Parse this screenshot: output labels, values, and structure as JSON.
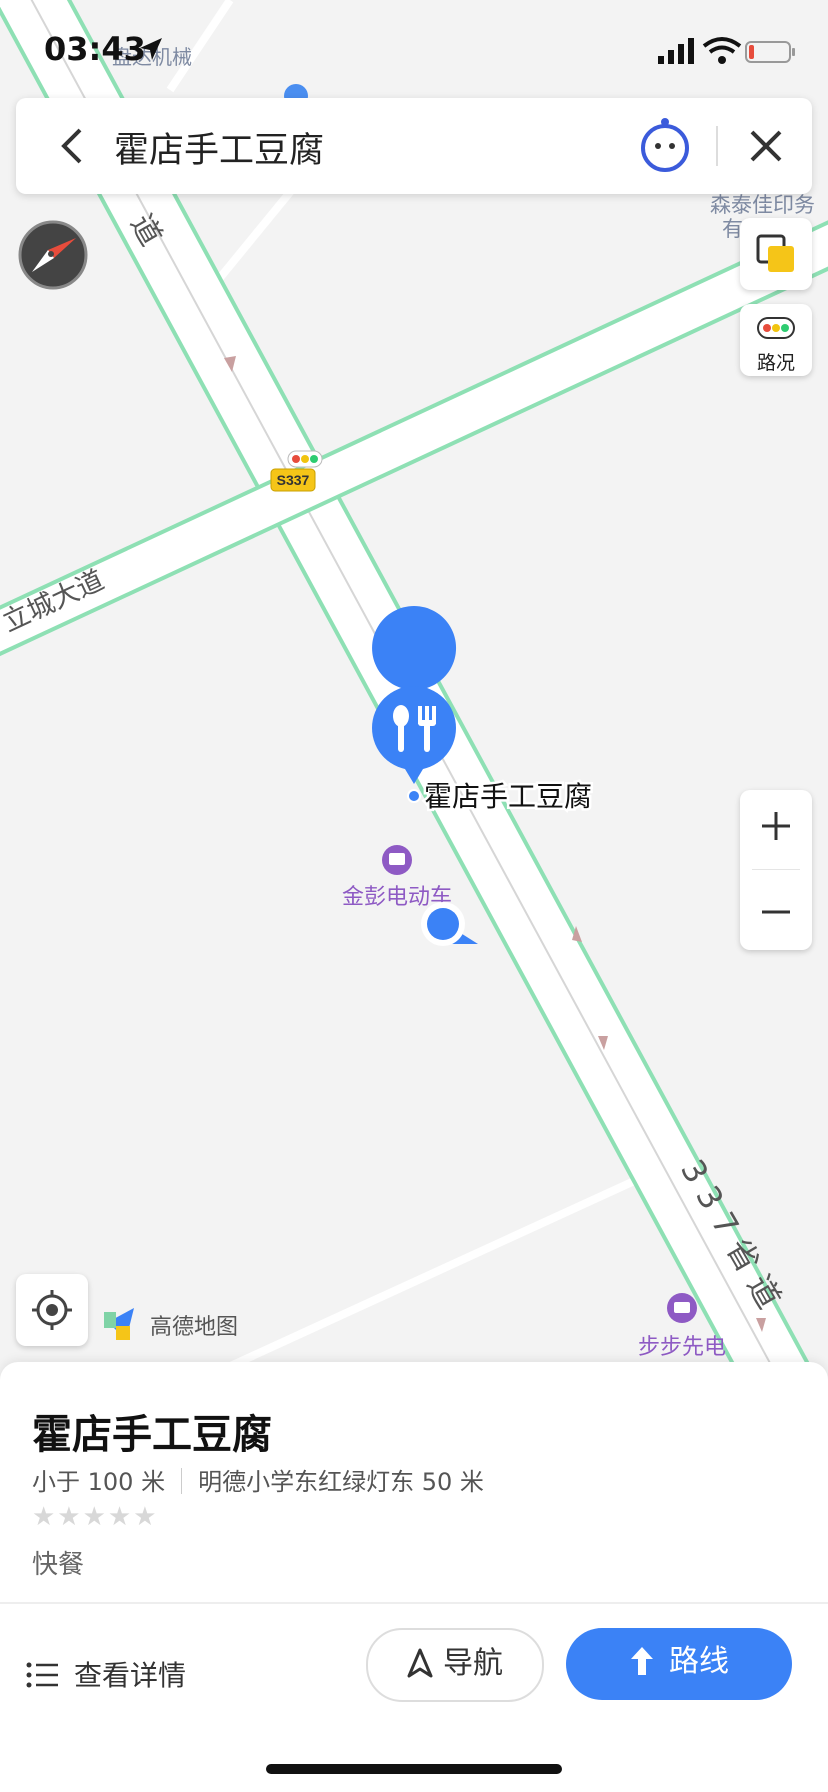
{
  "status_bar": {
    "time": "03:43"
  },
  "search": {
    "query": "霍店手工豆腐"
  },
  "map": {
    "labels": {
      "poi_top": "盘达机械",
      "road_left_vertical": "道",
      "road_left_diag": "立城大道",
      "road_shield": "S337",
      "poi_top_right": "森泰佳印务",
      "poi_top_right_2": "有",
      "selected_place": "霍店手工豆腐",
      "poi_ev": "金彭电动车",
      "road_right": "337省道",
      "poi_bottom_right": "步步先电",
      "brand": "高德地图"
    },
    "controls": {
      "traffic_label": "路况"
    }
  },
  "place": {
    "name": "霍店手工豆腐",
    "distance": "小于 100 米",
    "address": "明德小学东红绿灯东 50 米",
    "rating_stars": "★★★★★",
    "rating": 0,
    "category": "快餐"
  },
  "actions": {
    "details": "查看详情",
    "navigate": "导航",
    "route": "路线"
  },
  "colors": {
    "accent": "#3b82f6",
    "road_edge": "#8ee0b4",
    "map_bg": "#f3f3f3",
    "poi_purple": "#8e5ac4"
  }
}
